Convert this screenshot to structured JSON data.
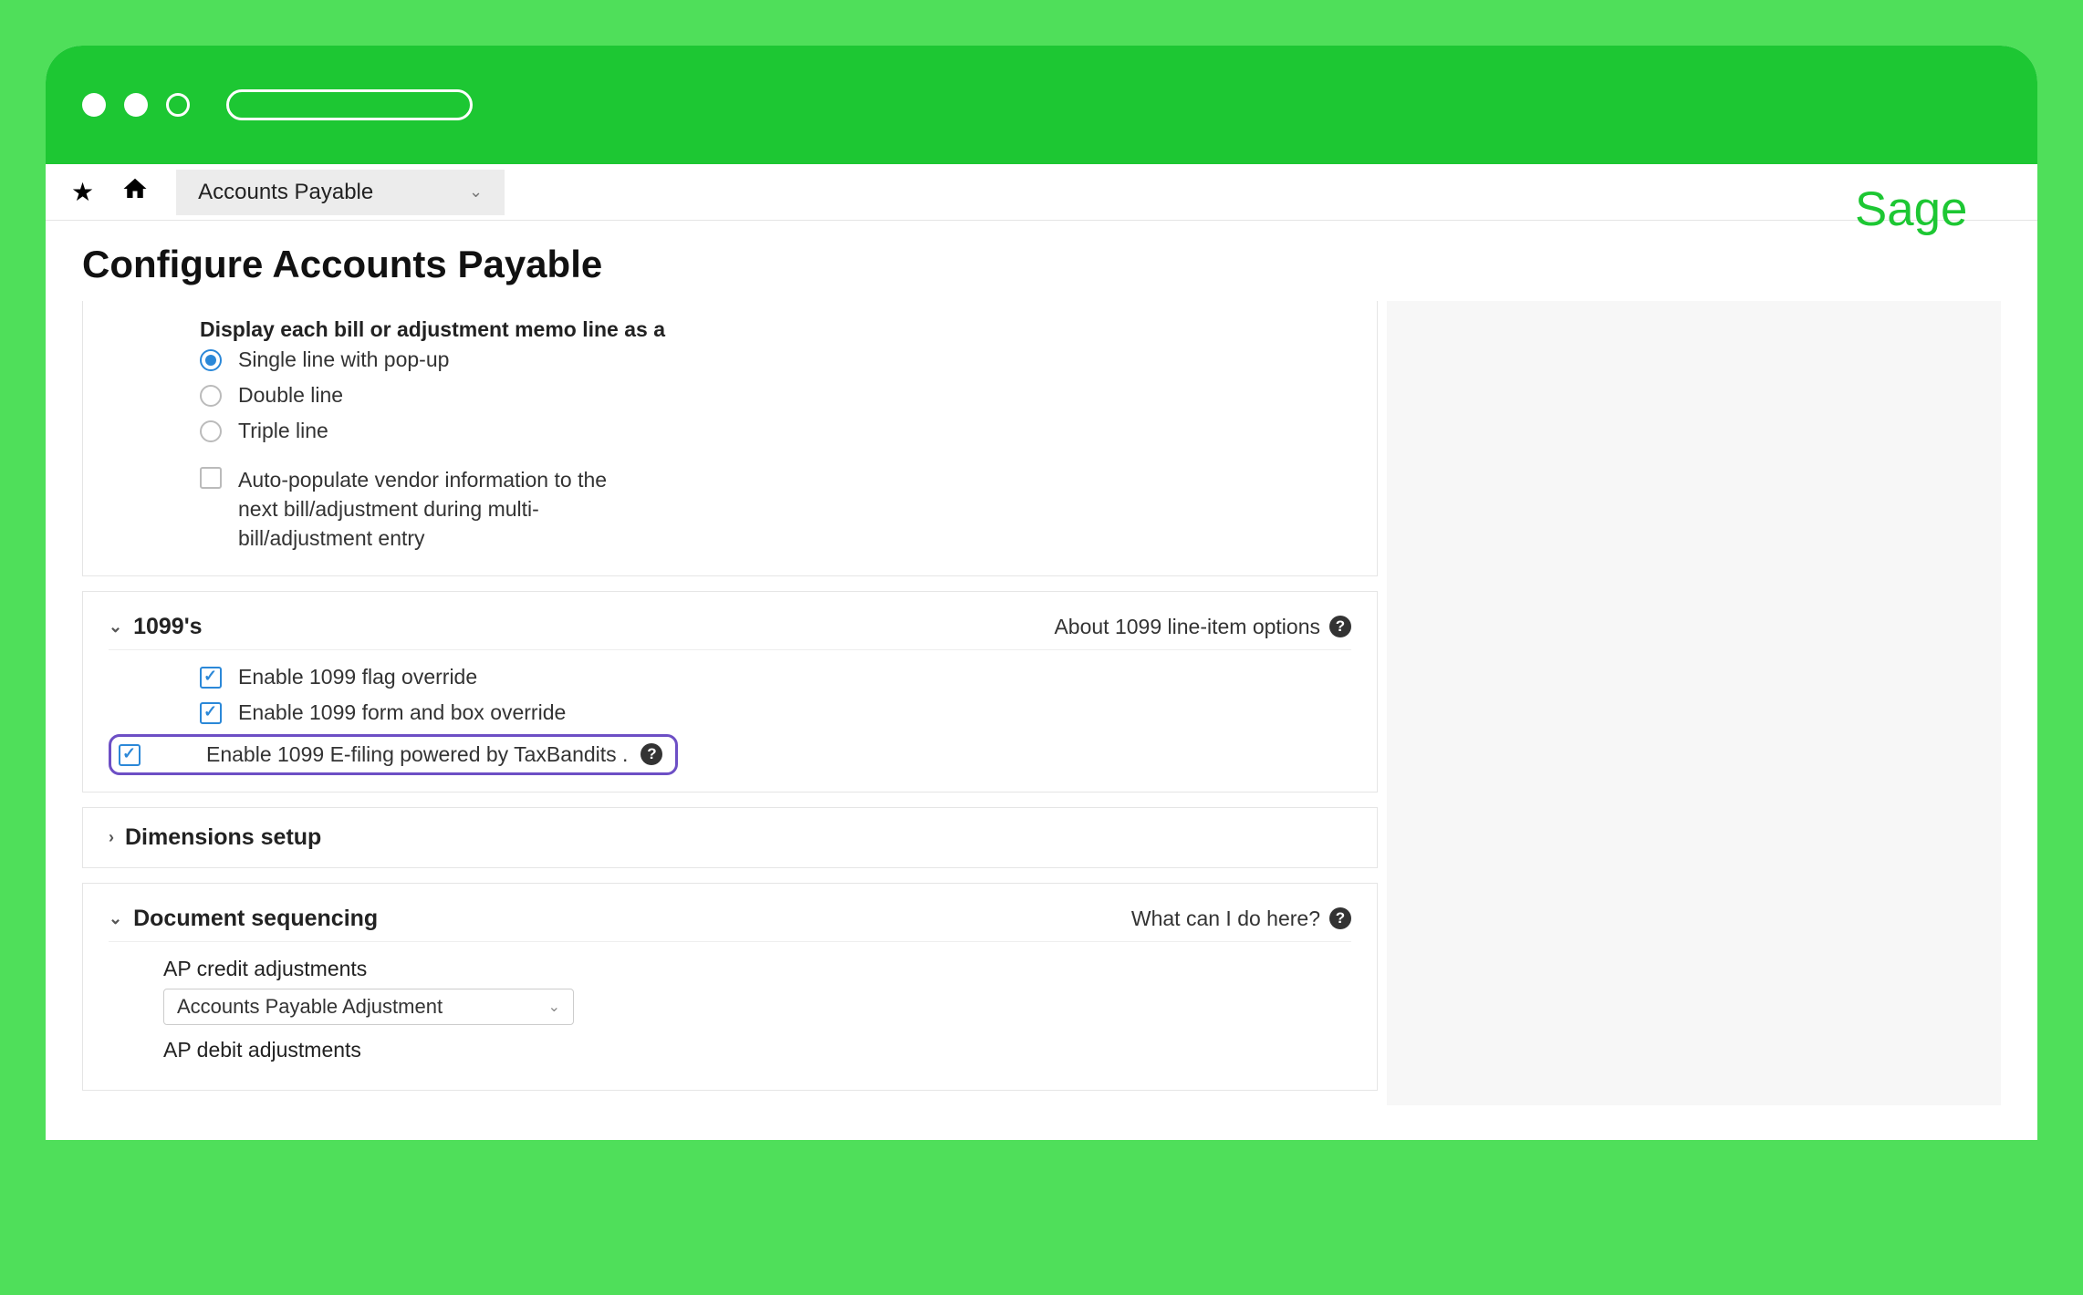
{
  "topbar": {
    "module": "Accounts Payable"
  },
  "page_title": "Configure Accounts Payable",
  "display_section": {
    "group_label": "Display each bill or adjustment memo line as a",
    "radios": {
      "single": "Single line with pop-up",
      "double": "Double line",
      "triple": "Triple line"
    },
    "auto_populate": "Auto-populate vendor information to the next bill/adjustment during multi-bill/adjustment entry"
  },
  "section_1099": {
    "title": "1099's",
    "help_text": "About 1099 line-item options",
    "checks": {
      "flag_override": "Enable 1099 flag override",
      "form_box_override": "Enable 1099 form and box override",
      "efiling": "Enable 1099 E-filing powered by TaxBandits ."
    }
  },
  "section_dimensions": {
    "title": "Dimensions setup"
  },
  "section_docseq": {
    "title": "Document sequencing",
    "help_text": "What can I do here?",
    "fields": {
      "ap_credit_label": "AP credit adjustments",
      "ap_credit_value": "Accounts Payable Adjustment",
      "ap_debit_label": "AP debit adjustments"
    }
  }
}
